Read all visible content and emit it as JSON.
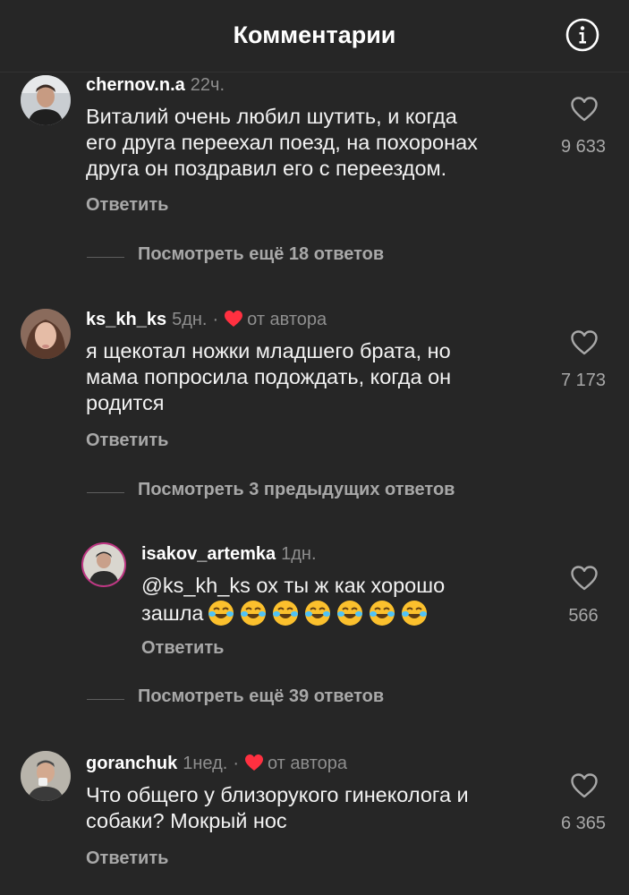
{
  "header": {
    "title": "Комментарии"
  },
  "comments": [
    {
      "username": "chernov.n.a",
      "time": "22ч.",
      "text_lines": [
        "Виталий очень любил шутить, и когда",
        "его друга переехал поезд, на похоронах",
        "друга он поздравил его с переездом."
      ],
      "reply_label": "Ответить",
      "likes": "9 633"
    },
    {
      "username": "ks_kh_ks",
      "time": "5дн.",
      "separator": "·",
      "author_label": "от автора",
      "text_lines": [
        "я щекотал ножки младшего брата, но",
        "мама попросила подождать, когда он",
        "родится"
      ],
      "reply_label": "Ответить",
      "likes": "7 173"
    },
    {
      "username": "isakov_artemka",
      "time": "1дн.",
      "text_line1": "@ks_kh_ks ох ты ж как хорошо",
      "text_line2": "зашла",
      "emoji": "😂😂😂😂😂😂😂",
      "reply_label": "Ответить",
      "likes": "566"
    },
    {
      "username": "goranchuk",
      "time": "1нед.",
      "separator": "·",
      "author_label": "от автора",
      "text_lines": [
        "Что общего у близорукого гинеколога и",
        "собаки? Мокрый нос"
      ],
      "reply_label": "Ответить",
      "likes": "6 365"
    }
  ],
  "view_more": [
    "Посмотреть ещё 18 ответов",
    "Посмотреть 3 предыдущих ответов",
    "Посмотреть ещё 39 ответов"
  ],
  "colors": {
    "background": "#262626",
    "primary_text": "#f2f2f2",
    "secondary_text": "#8e8e8e",
    "author_heart": "#ff3040"
  },
  "icons": [
    "info-icon",
    "heart-outline-icon",
    "filled-heart-icon",
    "tears-of-joy-emoji"
  ]
}
